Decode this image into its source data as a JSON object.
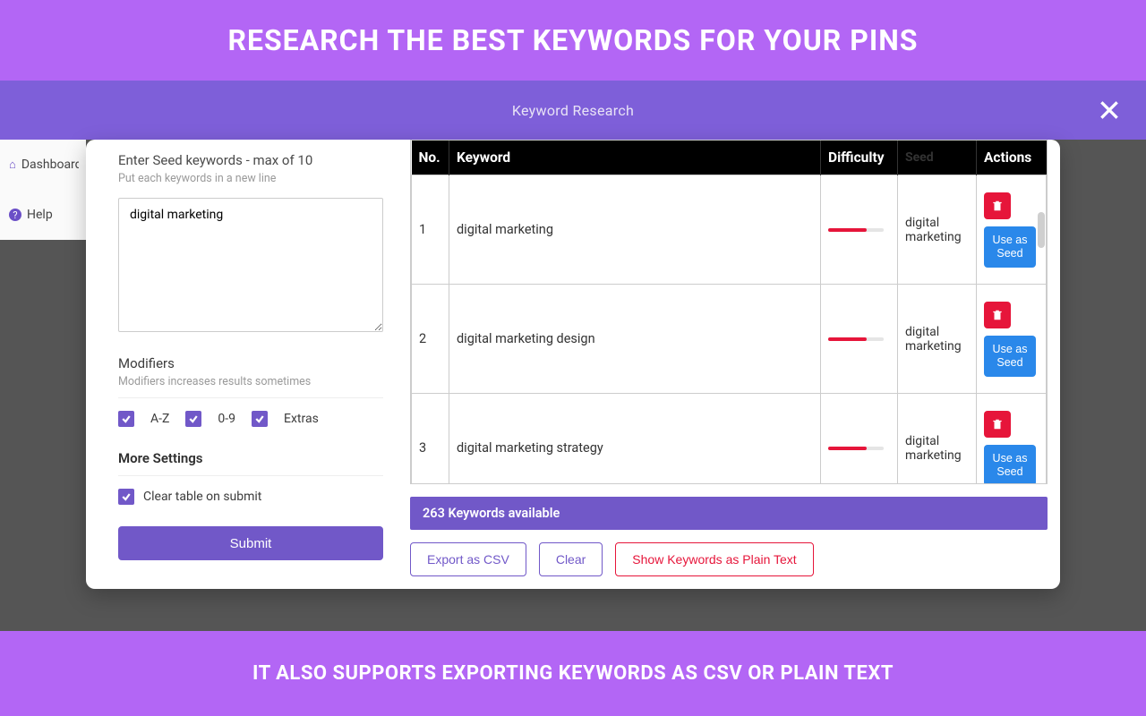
{
  "banners": {
    "top": "RESEARCH THE BEST KEYWORDS FOR YOUR PINS",
    "bottom": "IT ALSO SUPPORTS EXPORTING KEYWORDS AS CSV OR PLAIN TEXT"
  },
  "modal": {
    "title": "Keyword Research"
  },
  "sidenav": {
    "dashboard": "Dashboard",
    "help": "Help"
  },
  "seed": {
    "label": "Enter Seed keywords - max of 10",
    "hint": "Put each keywords in a new line",
    "value": "digital marketing"
  },
  "modifiers": {
    "title": "Modifiers",
    "hint": "Modifiers increases results sometimes",
    "opts": {
      "az": "A-Z",
      "num": "0-9",
      "extras": "Extras"
    }
  },
  "more": {
    "title": "More Settings",
    "clear_table": "Clear table on submit"
  },
  "submit_label": "Submit",
  "table": {
    "headers": {
      "no": "No.",
      "keyword": "Keyword",
      "difficulty": "Difficulty",
      "seed": "Seed",
      "actions": "Actions"
    },
    "actions": {
      "use_seed": "Use as Seed"
    },
    "rows": [
      {
        "no": "1",
        "keyword": "digital marketing",
        "seed": "digital marketing"
      },
      {
        "no": "2",
        "keyword": "digital marketing design",
        "seed": "digital marketing"
      },
      {
        "no": "3",
        "keyword": "digital marketing strategy",
        "seed": "digital marketing"
      }
    ]
  },
  "footer": {
    "available": "263 Keywords available",
    "export_csv": "Export as CSV",
    "clear": "Clear",
    "plain_text": "Show Keywords as Plain Text"
  }
}
